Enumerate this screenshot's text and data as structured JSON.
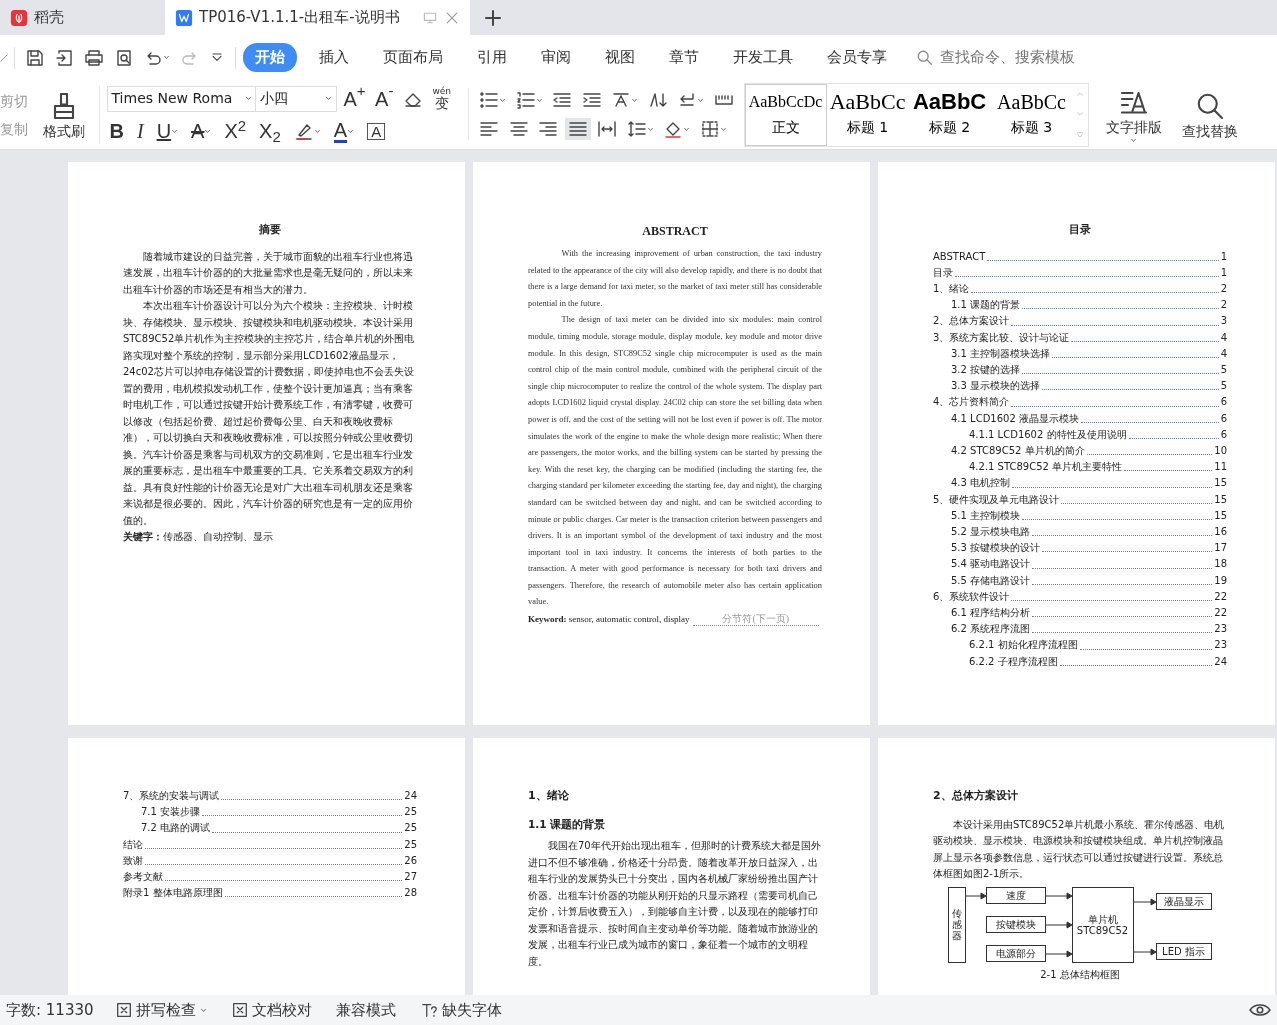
{
  "tabs": [
    {
      "title": "稻壳",
      "kind": "home",
      "selected": false
    },
    {
      "title": "TP016-V1.1.1-出租车-说明书",
      "kind": "doc",
      "selected": true
    }
  ],
  "menu": {
    "items": [
      {
        "label": "开始",
        "selected": true
      },
      {
        "label": "插入",
        "selected": false
      },
      {
        "label": "页面布局",
        "selected": false
      },
      {
        "label": "引用",
        "selected": false
      },
      {
        "label": "审阅",
        "selected": false
      },
      {
        "label": "视图",
        "selected": false
      },
      {
        "label": "章节",
        "selected": false
      },
      {
        "label": "开发工具",
        "selected": false
      },
      {
        "label": "会员专享",
        "selected": false
      }
    ],
    "search": {
      "placeholder": "查找命令、搜索模板"
    }
  },
  "ribbon": {
    "clipboard": [
      "剪切",
      "复制"
    ],
    "format_painter": "格式刷",
    "font": {
      "family": "Times New Roma",
      "size": "小四"
    },
    "font_tools": [
      "A$^{+}$",
      "A$^{-}$"
    ],
    "phonetic": {
      "top": "wén",
      "char": "变"
    },
    "format_buttons": [
      {
        "label": "B",
        "kind": "bold",
        "menu": false
      },
      {
        "label": "I",
        "kind": "italic",
        "menu": false
      },
      {
        "label": "U",
        "kind": "underline",
        "menu": true
      },
      {
        "label": "A",
        "kind": "strike",
        "menu": true
      },
      {
        "label": "X$^{2}$",
        "kind": "plain",
        "menu": false
      },
      {
        "label": "X$_{2}$",
        "kind": "plain",
        "menu": false
      },
      {
        "kind": "highlight",
        "menu": true
      },
      {
        "label": "A",
        "kind": "color",
        "menu": true
      },
      {
        "label": "A",
        "kind": "boxed",
        "menu": false
      }
    ],
    "styles": [
      {
        "preview": "AaBbCcDc",
        "label": "正文",
        "kind": "body",
        "selected": true
      },
      {
        "preview": "AaBbCc",
        "label": "标题 1",
        "kind": "h1",
        "selected": false
      },
      {
        "preview": "AaBbC",
        "label": "标题 2",
        "kind": "h2",
        "selected": false
      },
      {
        "preview": "AaBbCc",
        "label": "标题 3",
        "kind": "h3",
        "selected": false
      }
    ],
    "text_layout": "文字排版",
    "find_replace": "查找替换"
  },
  "pages": [
    {
      "blocks": [
        {
          "kind": "title",
          "text": "摘要"
        },
        {
          "kind": "para_cn",
          "text": "随着城市建设的日益完善，关于城市面貌的出租车行业也将迅速发展，出租车计价器的的大批量需求也是毫无疑问的，所以未来出租车计价器的市场还是有相当大的潜力。"
        },
        {
          "kind": "para_cn",
          "text": "本次出租车计价器设计可以分为六个模块：主控模块、计时模块、存储模块、显示模块、按键模块和电机驱动模块。本设计采用STC89C52单片机作为主控模块的主控芯片，结合单片机的外围电路实现对整个系统的控制，显示部分采用LCD1602液晶显示，24c02芯片可以掉电存储设置的计费数据，即使掉电也不会丢失设置的费用，电机模拟发动机工作，使整个设计更加逼真；当有乘客时电机工作，可以通过按键开始计费系统工作，有清零键，收费可以修改（包括起价费、超过起价费每公里、白天和夜晚收费标准），可以切换白天和夜晚收费标准，可以按照分钟或公里收费切换。汽车计价器是乘客与司机双方的交易准则，它是出租车行业发展的重要标志，是出租车中最重要的工具。它关系着交易双方的利益。具有良好性能的计价器无论是对广大出租车司机朋友还是乘客来说都是很必要的。因此，汽车计价器的研究也是有一定的应用价值的。"
        },
        {
          "kind": "keywords",
          "text": "**关键字：**传感器、自动控制、显示"
        }
      ]
    },
    {
      "blocks": [
        {
          "kind": "title_en",
          "text": "ABSTRACT"
        },
        {
          "kind": "para_en",
          "text": "With the increasing improvement of urban construction, the taxi industry related to the appearance of the city will also develop rapidly, and there is no doubt that there is a large demand for taxi meter, so the market of taxi meter still has considerable potential in the future."
        },
        {
          "kind": "para_en",
          "text": "The design of taxi meter can be divided into six modules: main control module, timing module, storage module, display module, key module and motor drive module. In this design, STC89C52 single chip microcomputer is used as the main control chip of the main control module, combined with the peripheral circuit of the single chip microcomputer to realize the control of the whole system. The display part adopts LCD1602 liquid crystal display. 24C02 chip can store the set billing data when power is off, and the cost of the setting will not be lost even if power is off. The motor simulates the work of the engine to make the whole design more realistic; When there are passengers, the motor works, and the billing system can be started by pressing the key. With the reset key, the charging can be modified (including the starting fee, the charging standard per kilometer exceeding the starting fee, day and night), the charging standard can be switched between day and night, and can be switched according to minute or public charges. Car meter is the transaction criterion between passengers and drivers. It is an important symbol of the development of taxi industry and the most important tool in taxi industry. It concerns the interests of both parties to the transaction. A meter with good performance is necessary for both taxi drivers and passengers. Therefore, the research of automobile meter also has certain application value."
        },
        {
          "kind": "keywords_en",
          "text": "**Keyword:** sensor, automatic control, display",
          "section_break": "分节符(下一页)"
        }
      ]
    },
    {
      "blocks": [
        {
          "kind": "title",
          "text": "目录"
        },
        {
          "kind": "toc",
          "entries": [
            {
              "title": "ABSTRACT",
              "page": "1"
            },
            {
              "title": "目录",
              "page": "1"
            },
            {
              "title": "1、绪论",
              "page": "2",
              "children": [
                {
                  "title": "1.1 课题的背景",
                  "page": "2"
                }
              ]
            },
            {
              "title": "2、总体方案设计",
              "page": "3"
            },
            {
              "title": "3、系统方案比较、设计与论证",
              "page": "4",
              "children": [
                {
                  "title": "3.1 主控制器模块选择",
                  "page": "4"
                },
                {
                  "title": "3.2 按键的选择",
                  "page": "5"
                },
                {
                  "title": "3.3 显示模块的选择",
                  "page": "5"
                }
              ]
            },
            {
              "title": "4、芯片资料简介",
              "page": "6",
              "children": [
                {
                  "title": "4.1 LCD1602 液晶显示模块",
                  "page": "6",
                  "children": [
                    {
                      "title": "4.1.1 LCD1602 的特性及使用说明",
                      "page": "6"
                    }
                  ]
                },
                {
                  "title": "4.2 STC89C52 单片机的简介",
                  "page": "10",
                  "children": [
                    {
                      "title": "4.2.1 STC89C52 单片机主要特性",
                      "page": "11"
                    }
                  ]
                },
                {
                  "title": "4.3 电机控制",
                  "page": "15"
                }
              ]
            },
            {
              "title": "5、硬件实现及单元电路设计",
              "page": "15",
              "children": [
                {
                  "title": "5.1 主控制模块",
                  "page": "15"
                },
                {
                  "title": "5.2 显示模块电路",
                  "page": "16"
                },
                {
                  "title": "5.3 按键模块的设计",
                  "page": "17"
                },
                {
                  "title": "5.4 驱动电路设计",
                  "page": "18"
                },
                {
                  "title": "5.5 存储电路设计",
                  "page": "19"
                }
              ]
            },
            {
              "title": "6、系统软件设计",
              "page": "22",
              "children": [
                {
                  "title": "6.1 程序结构分析",
                  "page": "22"
                },
                {
                  "title": "6.2 系统程序流图",
                  "page": "23",
                  "children": [
                    {
                      "title": "6.2.1 初始化程序流程图",
                      "page": "23"
                    },
                    {
                      "title": "6.2.2 子程序流程图",
                      "page": "24"
                    }
                  ]
                }
              ]
            }
          ]
        }
      ]
    },
    {
      "blocks": [
        {
          "kind": "toc",
          "entries": [
            {
              "title": "7、系统的安装与调试",
              "page": "24",
              "children": [
                {
                  "title": "7.1 安装步骤",
                  "page": "25"
                },
                {
                  "title": "7.2 电路的调试",
                  "page": "25"
                }
              ]
            },
            {
              "title": "结论",
              "page": "25"
            },
            {
              "title": "致谢",
              "page": "26"
            },
            {
              "title": "参考文献",
              "page": "27"
            },
            {
              "title": "附录1 整体电路原理图",
              "page": "28"
            }
          ]
        }
      ]
    },
    {
      "blocks": [
        {
          "kind": "heading",
          "text": "1、绪论"
        },
        {
          "kind": "subheading",
          "text": "1.1 课题的背景"
        },
        {
          "kind": "para_cn",
          "text": "我国在70年代开始出现出租车，但那时的计费系统大都是国外进口不但不够准确，价格还十分昂贵。随着改革开放日益深入，出租车行业的发展势头已十分突出，国内各机械厂家纷纷推出国产计价器。出租车计价器的功能从刚开始的只显示路程（需要司机自己定价，计算后收费五入），到能够自主计费，以及现在的能够打印发票和语音提示、按时间自主变动单价等功能。随着城市旅游业的发展，出租车行业已成为城市的窗口，象征着一个城市的文明程度。"
        }
      ]
    },
    {
      "blocks": [
        {
          "kind": "heading",
          "text": "2、总体方案设计"
        },
        {
          "kind": "para_cn",
          "text": "本设计采用由STC89C52单片机最小系统、霍尔传感器、电机驱动模块、显示模块、电源模块和按键模块组成。单片机控制液晶屏上显示各项参数信息，运行状态可以通过按键进行设置。系统总体框图如图2-1所示。"
        },
        {
          "kind": "diagram",
          "nodes": [
            {
              "label": "传感器",
              "kind": "sensor"
            },
            {
              "label": "速度",
              "kind": "input"
            },
            {
              "label": "按键模块",
              "kind": "input"
            },
            {
              "label": "电源部分",
              "kind": "input"
            },
            {
              "label": "单片机 STC89C52",
              "kind": "mcu"
            },
            {
              "label": "液晶显示",
              "kind": "output"
            },
            {
              "label": "LED 指示",
              "kind": "output"
            }
          ],
          "caption": "2-1 总体结构框图"
        }
      ]
    }
  ],
  "status_bar": {
    "word_count": "字数: 11330",
    "items": [
      {
        "label": "拼写检查",
        "menu": true
      },
      {
        "label": "文档校对",
        "menu": false
      },
      {
        "label": "兼容模式",
        "menu": false
      },
      {
        "label": "缺失字体",
        "menu": false
      }
    ]
  }
}
